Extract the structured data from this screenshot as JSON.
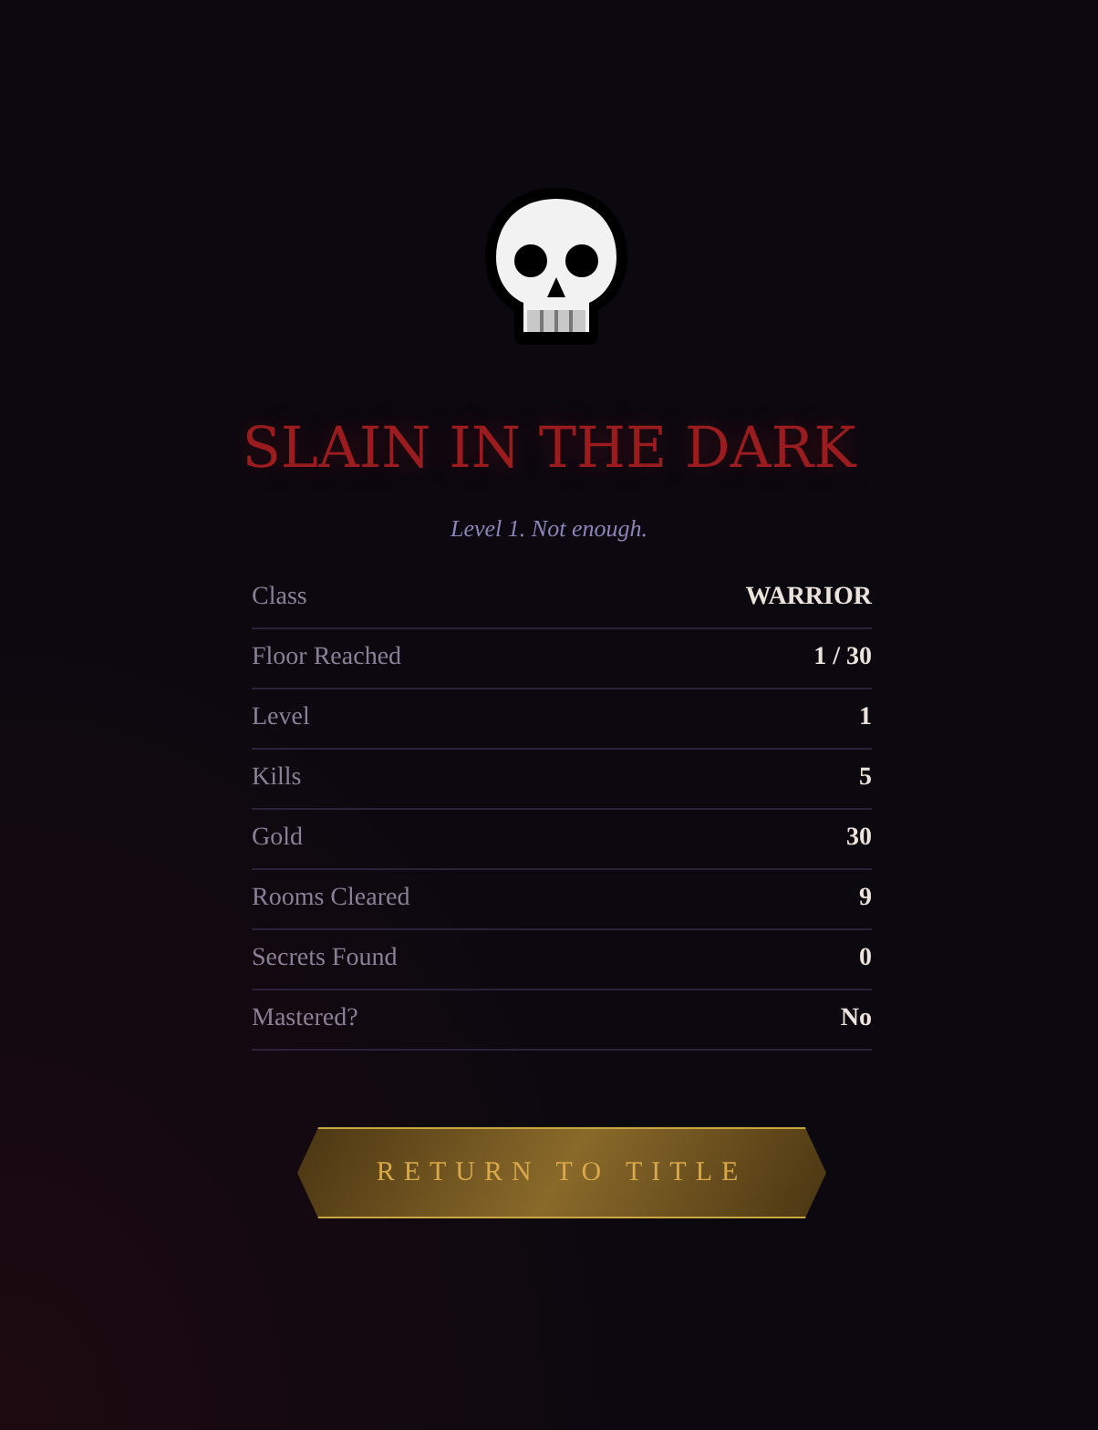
{
  "title": "SLAIN IN THE DARK",
  "subtitle": "Level 1. Not enough.",
  "stats": [
    {
      "label": "Class",
      "value": "WARRIOR"
    },
    {
      "label": "Floor Reached",
      "value": "1 / 30"
    },
    {
      "label": "Level",
      "value": "1"
    },
    {
      "label": "Kills",
      "value": "5"
    },
    {
      "label": "Gold",
      "value": "30"
    },
    {
      "label": "Rooms Cleared",
      "value": "9"
    },
    {
      "label": "Secrets Found",
      "value": "0"
    },
    {
      "label": "Mastered?",
      "value": "No"
    }
  ],
  "button": "RETURN TO TITLE"
}
